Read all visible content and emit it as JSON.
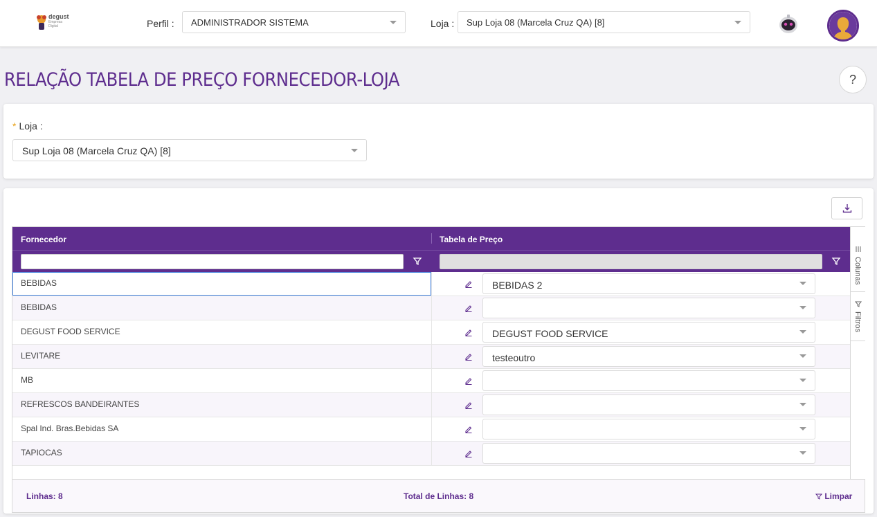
{
  "header": {
    "logo_text": "degust",
    "logo_sub": "Empresa Digital",
    "perfil_label": "Perfil :",
    "perfil_value": "ADMINISTRADOR SISTEMA",
    "loja_label": "Loja :",
    "loja_value": "Sup Loja 08 (Marcela Cruz QA) [8]"
  },
  "page": {
    "title": "RELAÇÃO TABELA DE PREÇO FORNECEDOR-LOJA",
    "help_label": "?"
  },
  "form": {
    "loja_label": "Loja :",
    "required_mark": "*",
    "loja_value": "Sup Loja 08 (Marcela Cruz QA) [8]"
  },
  "grid": {
    "columns": [
      "Fornecedor",
      "Tabela de Preço"
    ],
    "side_tabs": [
      "Colunas",
      "Filtros"
    ],
    "rows": [
      {
        "fornecedor": "BEBIDAS",
        "tabela": "BEBIDAS 2"
      },
      {
        "fornecedor": "BEBIDAS",
        "tabela": ""
      },
      {
        "fornecedor": "DEGUST FOOD SERVICE",
        "tabela": "DEGUST FOOD SERVICE"
      },
      {
        "fornecedor": "LEVITARE",
        "tabela": "testeoutro"
      },
      {
        "fornecedor": "MB",
        "tabela": ""
      },
      {
        "fornecedor": "REFRESCOS BANDEIRANTES",
        "tabela": ""
      },
      {
        "fornecedor": "Spal Ind. Bras.Bebidas SA",
        "tabela": ""
      },
      {
        "fornecedor": "TAPIOCAS",
        "tabela": ""
      }
    ],
    "footer": {
      "linhas": "Linhas: 8",
      "total": "Total de Linhas: 8",
      "limpar": "Limpar"
    }
  },
  "colors": {
    "brand": "#5e2d8e",
    "required": "#e8a21a"
  }
}
